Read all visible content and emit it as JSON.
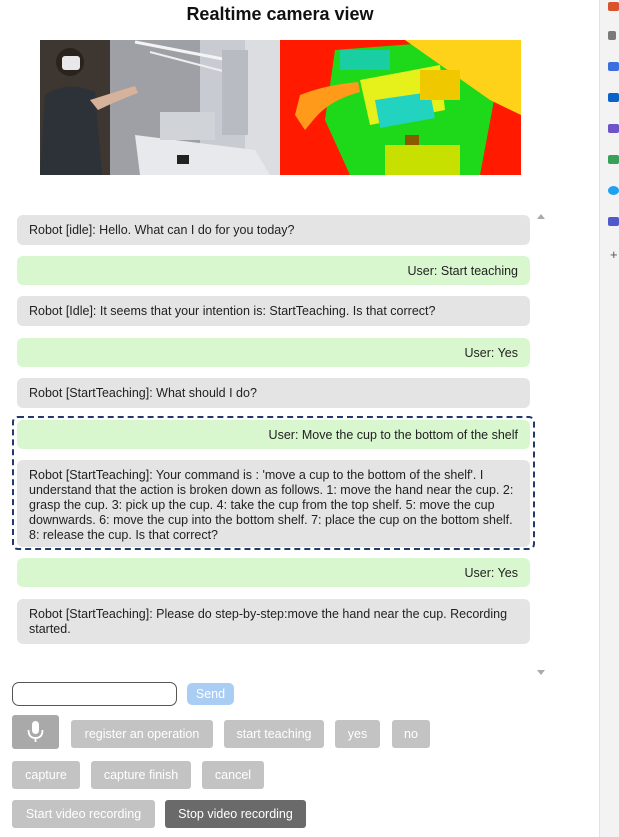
{
  "title": "Realtime camera view",
  "messages": [
    {
      "role": "robot",
      "text": "Robot [idle]: Hello. What can I do for you today?"
    },
    {
      "role": "user",
      "text": "User: Start teaching"
    },
    {
      "role": "robot",
      "text": "Robot [Idle]: It seems that your intention is: StartTeaching. Is that correct?"
    },
    {
      "role": "user",
      "text": "User: Yes"
    },
    {
      "role": "robot",
      "text": "Robot [StartTeaching]: What should I do?"
    },
    {
      "role": "user",
      "text": "User: Move the cup to the bottom of the shelf"
    },
    {
      "role": "robot",
      "text": "Robot [StartTeaching]: Your command is : 'move a cup to the bottom of the shelf'. I understand that the action is broken down as follows. 1: move the hand near the cup. 2: grasp the cup. 3: pick up the cup. 4: take the cup from the top shelf. 5: move the cup downwards. 6: move the cup into the bottom shelf. 7: place the cup on the bottom shelf. 8: release the cup. Is that correct?"
    },
    {
      "role": "user",
      "text": "User: Yes"
    },
    {
      "role": "robot",
      "text": "Robot [StartTeaching]: Please do step-by-step:move the hand near the cup. Recording started."
    }
  ],
  "input": {
    "value": "",
    "placeholder": ""
  },
  "buttons": {
    "send": "Send",
    "register": "register an operation",
    "start_teaching": "start teaching",
    "yes": "yes",
    "no": "no",
    "capture": "capture",
    "capture_finish": "capture finish",
    "cancel": "cancel",
    "start_video": "Start video recording",
    "stop_video": "Stop video recording"
  },
  "icons": {
    "microphone": "microphone-icon",
    "scroll_up": "scroll-up-arrow-icon",
    "scroll_down": "scroll-down-arrow-icon"
  },
  "colors": {
    "robot_bubble": "#e4e4e4",
    "user_bubble": "#d9f7cf",
    "highlight_border": "#1f3a6b",
    "send_button": "#a9cdf3",
    "button_gray": "#c3c3c3",
    "button_dark": "#6a6a6a"
  }
}
